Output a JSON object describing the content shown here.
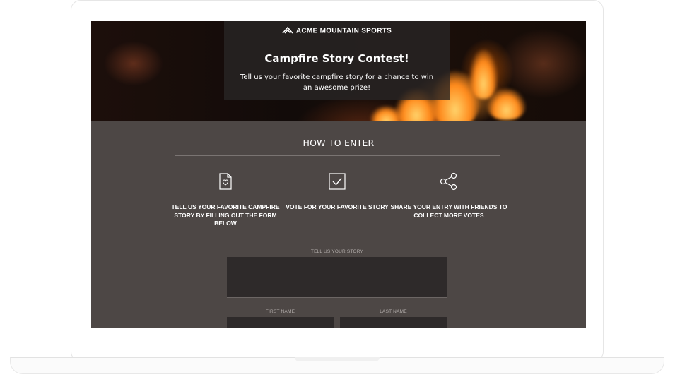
{
  "hero": {
    "brand": "ACME MOUNTAIN SPORTS",
    "title": "Campfire Story Contest!",
    "subtitle": "Tell us your favorite campfire story for a chance to win an awesome prize!"
  },
  "how_to_enter": {
    "title": "HOW TO ENTER",
    "steps": [
      {
        "icon": "document-heart-icon",
        "text": "TELL US YOUR FAVORITE CAMPFIRE STORY BY FILLING OUT THE FORM BELOW"
      },
      {
        "icon": "checkbox-icon",
        "text": "VOTE FOR YOUR FAVORITE STORY"
      },
      {
        "icon": "share-icon",
        "text": "SHARE YOUR ENTRY WITH FRIENDS TO COLLECT MORE VOTES"
      }
    ]
  },
  "form": {
    "story_label": "TELL US YOUR STORY",
    "first_name_label": "FIRST NAME",
    "last_name_label": "LAST NAME"
  },
  "colors": {
    "page_bg": "#4d4745",
    "input_bg": "#2e2a2a",
    "flame": "#ff8a1c"
  }
}
